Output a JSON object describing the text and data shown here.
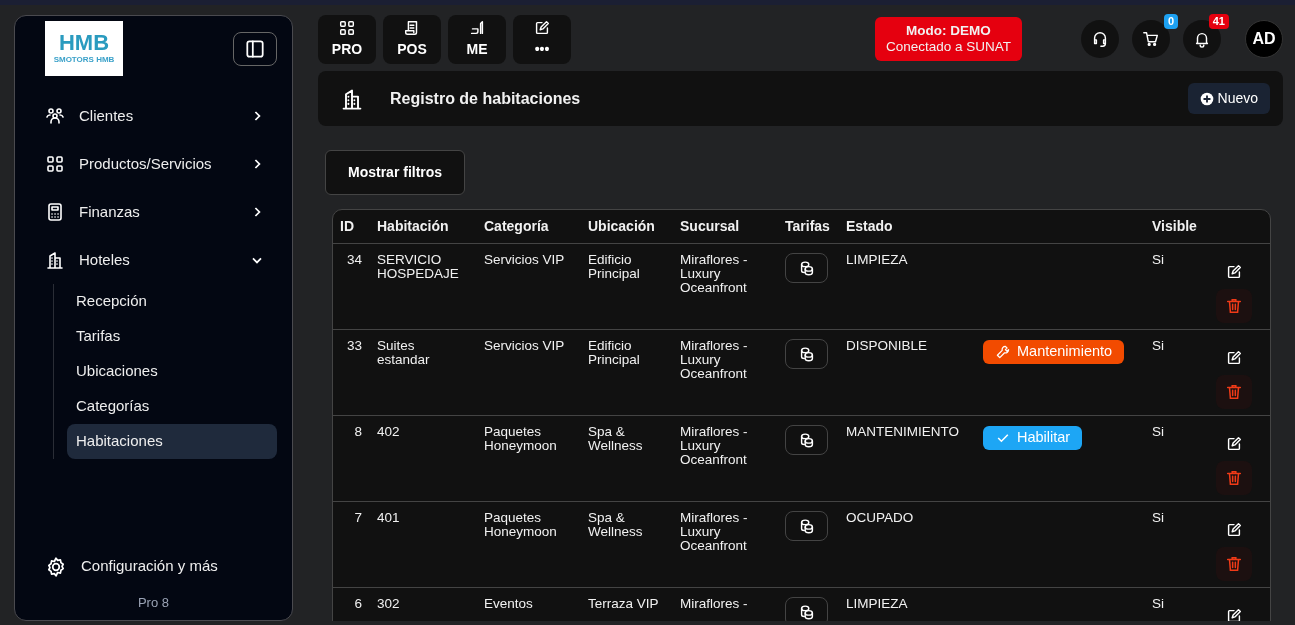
{
  "logo": {
    "mark": "HMB",
    "caption": "SMOTORS HMB"
  },
  "sidebar": {
    "items": [
      {
        "label": "Clientes",
        "expanded": false
      },
      {
        "label": "Productos/Servicios",
        "expanded": false
      },
      {
        "label": "Finanzas",
        "expanded": false
      },
      {
        "label": "Hoteles",
        "expanded": true,
        "children": [
          {
            "label": "Recepción",
            "selected": false
          },
          {
            "label": "Tarifas",
            "selected": false
          },
          {
            "label": "Ubicaciones",
            "selected": false
          },
          {
            "label": "Categorías",
            "selected": false
          },
          {
            "label": "Habitaciones",
            "selected": true
          }
        ]
      }
    ],
    "footer_link": "Configuración y más",
    "version": "Pro 8"
  },
  "toolbar": [
    {
      "label": "PRO"
    },
    {
      "label": "POS"
    },
    {
      "label": "ME"
    },
    {
      "label": "•••"
    }
  ],
  "mode_badge": {
    "title": "Modo: DEMO",
    "subtitle": "Conectado a SUNAT"
  },
  "header_icons": [
    {
      "kind": "support"
    },
    {
      "kind": "cart",
      "count": "0",
      "color": "#1da1f2"
    },
    {
      "kind": "notifications",
      "count": "41",
      "color": "#e5000f"
    }
  ],
  "avatar": "AD",
  "page_header": {
    "title": "Registro de habitaciones",
    "new_button": "Nuevo"
  },
  "filters_button": "Mostrar filtros",
  "table": {
    "columns": [
      "ID",
      "Habitación",
      "Categoría",
      "Ubicación",
      "Sucursal",
      "Tarifas",
      "Estado",
      "Visible"
    ],
    "rows": [
      {
        "id": "34",
        "room": "SERVICIO HOSPEDAJE",
        "category": "Servicios VIP",
        "location": "Edificio Principal",
        "branch": "Miraflores - Luxury Oceanfront",
        "status": "LIMPIEZA",
        "visible": "Si"
      },
      {
        "id": "33",
        "room": "Suites estandar",
        "category": "Servicios VIP",
        "location": "Edificio Principal",
        "branch": "Miraflores - Luxury Oceanfront",
        "status": "DISPONIBLE",
        "action": {
          "kind": "maintenance",
          "label": "Mantenimiento"
        },
        "visible": "Si"
      },
      {
        "id": "8",
        "room": "402",
        "category": "Paquetes Honeymoon",
        "location": "Spa & Wellness",
        "branch": "Miraflores - Luxury Oceanfront",
        "status": "MANTENIMIENTO",
        "action": {
          "kind": "enable",
          "label": "Habilitar"
        },
        "visible": "Si"
      },
      {
        "id": "7",
        "room": "401",
        "category": "Paquetes Honeymoon",
        "location": "Spa & Wellness",
        "branch": "Miraflores - Luxury Oceanfront",
        "status": "OCUPADO",
        "visible": "Si"
      },
      {
        "id": "6",
        "room": "302",
        "category": "Eventos",
        "location": "Terraza VIP",
        "branch": "Miraflores -",
        "status": "LIMPIEZA",
        "visible": "Si"
      }
    ]
  }
}
